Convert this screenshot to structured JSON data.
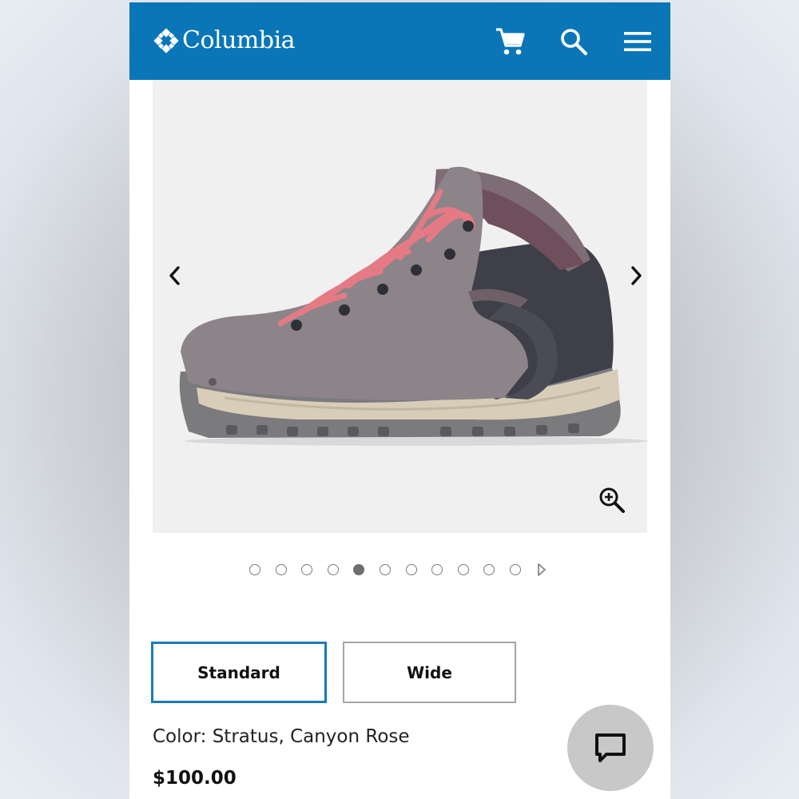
{
  "header": {
    "brand": "Columbia",
    "brand_color": "#0a76b8",
    "icons": [
      "cart-icon",
      "search-icon",
      "menu-icon"
    ]
  },
  "gallery": {
    "prev_icon": "chevron-left-icon",
    "next_icon": "chevron-right-icon",
    "zoom_icon": "zoom-in-icon",
    "image_subject": "boot-image",
    "dot_count": 11,
    "active_index": 4
  },
  "width_options": {
    "standard_label": "Standard",
    "wide_label": "Wide",
    "selected": "Standard",
    "selected_color": "#1a7bb8"
  },
  "product": {
    "color_label": "Color: Stratus, Canyon Rose",
    "price": "$100.00"
  },
  "chat": {
    "icon": "chat-icon"
  }
}
